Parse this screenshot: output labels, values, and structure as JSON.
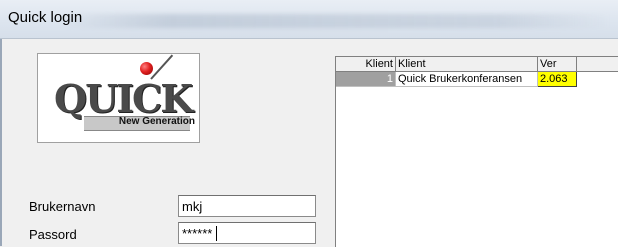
{
  "window": {
    "title": "Quick login"
  },
  "logo": {
    "brand": "QUICK",
    "tagline": "New Generation"
  },
  "login": {
    "username_label": "Brukernavn",
    "username_value": "mkj",
    "password_label": "Passord",
    "password_value": "******"
  },
  "grid": {
    "columns": [
      "Klient",
      "Klient",
      "Ver"
    ],
    "rows": [
      {
        "id": "1",
        "name": "Quick Brukerkonferansen",
        "version": "2.063"
      }
    ]
  },
  "colors": {
    "highlight": "#ffff00",
    "title_bar": "#dde5ef"
  }
}
